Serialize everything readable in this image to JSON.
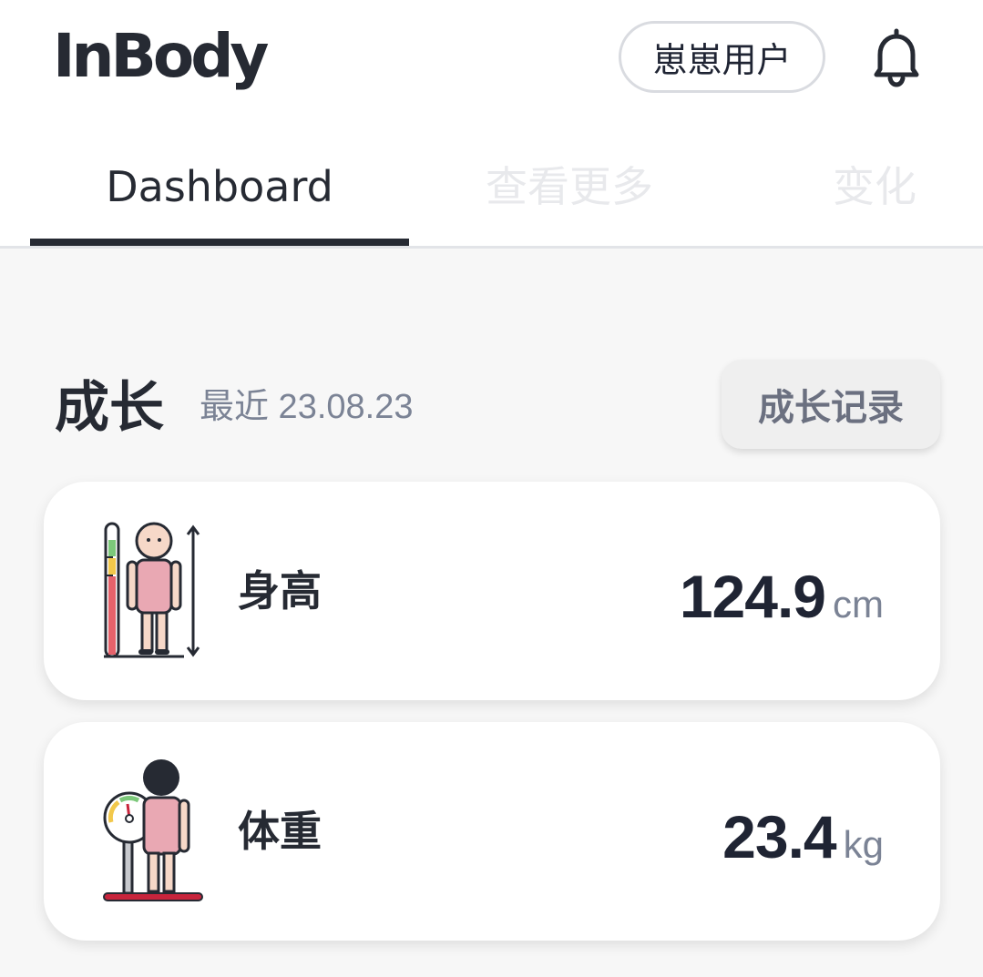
{
  "header": {
    "logo_text": "InBody",
    "user_name": "崽崽用户",
    "notification_icon": "bell-icon"
  },
  "tabs": [
    {
      "label": "Dashboard",
      "active": true
    },
    {
      "label": "查看更多",
      "active": false
    },
    {
      "label": "变化",
      "active": false
    }
  ],
  "growth": {
    "title": "成长",
    "date_text": "最近 23.08.23",
    "record_button": "成长记录"
  },
  "metrics": [
    {
      "label": "身高",
      "value": "124.9",
      "unit": "cm",
      "icon": "height-measure-icon"
    },
    {
      "label": "体重",
      "value": "23.4",
      "unit": "kg",
      "icon": "weight-scale-icon"
    }
  ],
  "colors": {
    "text_dark": "#262a33",
    "text_muted": "#7b8395",
    "tab_inactive": "#e8e9ec",
    "background": "#f7f7f7",
    "card": "#ffffff",
    "accent_red": "#c8243c",
    "figure_pink": "#e9a8b3"
  }
}
